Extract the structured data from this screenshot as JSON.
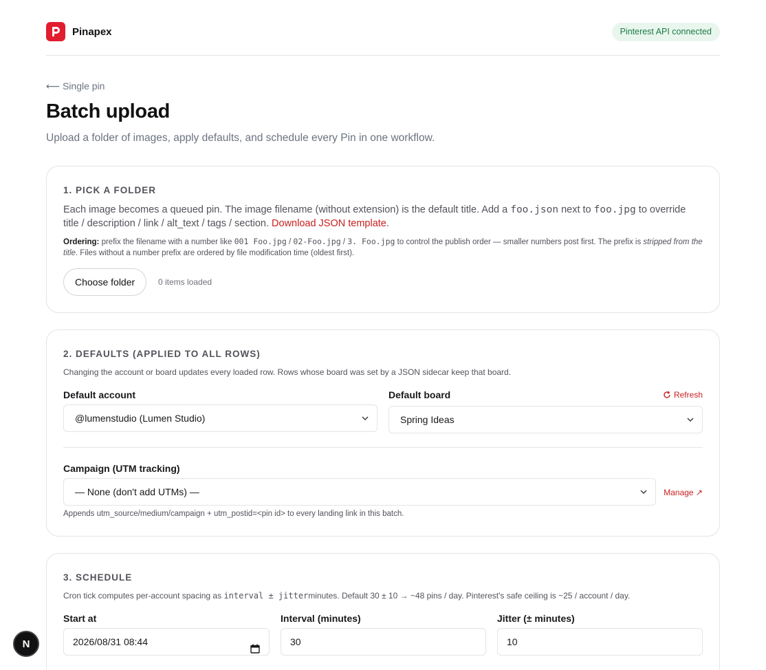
{
  "app": {
    "brand": "Pinapex",
    "api_status": "Pinterest API connected"
  },
  "nav": {
    "back_label": "⟵ Single pin"
  },
  "page": {
    "title": "Batch upload",
    "subtitle": "Upload a folder of images, apply defaults, and schedule every Pin in one workflow."
  },
  "pick_folder": {
    "heading": "1. PICK A FOLDER",
    "desc_part1": "Each image becomes a queued pin. The image filename (without extension) is the default title. Add a ",
    "desc_code1": "foo.json",
    "desc_part2": " next to ",
    "desc_code2": "foo.jpg",
    "desc_part3": " to override title / description / link / alt_text / tags / section. ",
    "template_link": "Download JSON template",
    "desc_end": ".",
    "ordering_label": "Ordering:",
    "ordering_part1": " prefix the filename with a number like ",
    "ordering_code1": "001 Foo.jpg",
    "sep1": " / ",
    "ordering_code2": "02-Foo.jpg",
    "sep2": " / ",
    "ordering_code3": "3. Foo.jpg",
    "ordering_part2": " to control the publish order — smaller numbers post first. The prefix is ",
    "ordering_em": "stripped from the title",
    "ordering_part3": ". Files without a number prefix are ordered by file modification time (oldest first).",
    "choose_button": "Choose folder",
    "items_loaded": "0 items loaded"
  },
  "defaults": {
    "heading": "2. DEFAULTS (APPLIED TO ALL ROWS)",
    "desc": "Changing the account or board updates every loaded row. Rows whose board was set by a JSON sidecar keep that board.",
    "account_label": "Default account",
    "account_value": "@lumenstudio (Lumen Studio)",
    "board_label": "Default board",
    "refresh_label": "Refresh",
    "board_value": "Spring Ideas",
    "campaign_label": "Campaign (UTM tracking)",
    "campaign_value": "— None (don't add UTMs) —",
    "manage_label": "Manage ↗",
    "campaign_help": "Appends utm_source/medium/campaign + utm_postid=<pin id> to every landing link in this batch."
  },
  "schedule": {
    "heading": "3. SCHEDULE",
    "desc_part1": "Cron tick computes per-account spacing as ",
    "desc_code": "interval ± jitter",
    "desc_part2": "minutes. Default 30 ± 10 → ~48 pins / day. Pinterest's safe ceiling is ~25 / account / day.",
    "start_label": "Start at",
    "start_value": "2026/08/31 08:44",
    "interval_label": "Interval (minutes)",
    "interval_value": "30",
    "jitter_label": "Jitter (± minutes)",
    "jitter_value": "10"
  },
  "dev": {
    "badge": "N"
  },
  "colors": {
    "brand_red": "#e11d2e",
    "link_red": "#c81e1e",
    "success_bg": "#e9f6ee",
    "success_text": "#1c7a45"
  }
}
